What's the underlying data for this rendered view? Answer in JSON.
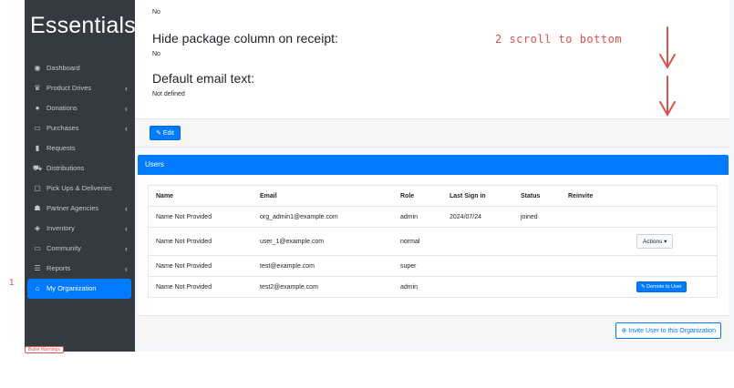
{
  "sidebar": {
    "brand": "Essentials",
    "items": [
      {
        "label": "Dashboard",
        "icon": "gauge-icon",
        "glyph": "◉",
        "chevron": false
      },
      {
        "label": "Product Drives",
        "icon": "trophy-icon",
        "glyph": "♛",
        "chevron": true
      },
      {
        "label": "Donations",
        "icon": "donate-icon",
        "glyph": "●",
        "chevron": true
      },
      {
        "label": "Purchases",
        "icon": "money-icon",
        "glyph": "▭",
        "chevron": true
      },
      {
        "label": "Requests",
        "icon": "file-icon",
        "glyph": "▮",
        "chevron": false
      },
      {
        "label": "Distributions",
        "icon": "cart-icon",
        "glyph": "⛟",
        "chevron": false
      },
      {
        "label": "Pick Ups & Deliveries",
        "icon": "calendar-icon",
        "glyph": "▢",
        "chevron": false
      },
      {
        "label": "Partner Agencies",
        "icon": "users-icon",
        "glyph": "☗",
        "chevron": true
      },
      {
        "label": "Inventory",
        "icon": "cubes-icon",
        "glyph": "◈",
        "chevron": true
      },
      {
        "label": "Community",
        "icon": "laptop-icon",
        "glyph": "▭",
        "chevron": true
      },
      {
        "label": "Reports",
        "icon": "list-icon",
        "glyph": "☰",
        "chevron": true
      },
      {
        "label": "My Organization",
        "icon": "home-icon",
        "glyph": "⌂",
        "chevron": false,
        "active": true
      }
    ],
    "chevron_glyph": "‹"
  },
  "annotations": {
    "step1": "1",
    "step2": "2 scroll to bottom"
  },
  "bullet_warning": "Bullet Warnings",
  "settings": {
    "top_value": "No",
    "hide_package_title": "Hide package column on receipt:",
    "hide_package_value": "No",
    "default_email_title": "Default email text:",
    "default_email_value": "Not defined"
  },
  "edit_button": "Edit",
  "users": {
    "header": "Users",
    "columns": [
      "Name",
      "Email",
      "Role",
      "Last Sign in",
      "Status",
      "Reinvite",
      ""
    ],
    "rows": [
      {
        "name": "Name Not Provided",
        "email": "org_admin1@example.com",
        "role": "admin",
        "last_sign_in": "2024/07/24",
        "status": "joined",
        "action": ""
      },
      {
        "name": "Name Not Provided",
        "email": "user_1@example.com",
        "role": "normal",
        "last_sign_in": "",
        "status": "",
        "action": "Actions"
      },
      {
        "name": "Name Not Provided",
        "email": "test@example.com",
        "role": "super",
        "last_sign_in": "",
        "status": "",
        "action": ""
      },
      {
        "name": "Name Not Provided",
        "email": "test2@example.com",
        "role": "admin",
        "last_sign_in": "",
        "status": "",
        "action": "Demote to User"
      }
    ],
    "invite_button": "Invite User to this Organization"
  },
  "colors": {
    "sidebar_bg": "#343a40",
    "primary": "#007bff",
    "annotation": "#d9534f"
  }
}
